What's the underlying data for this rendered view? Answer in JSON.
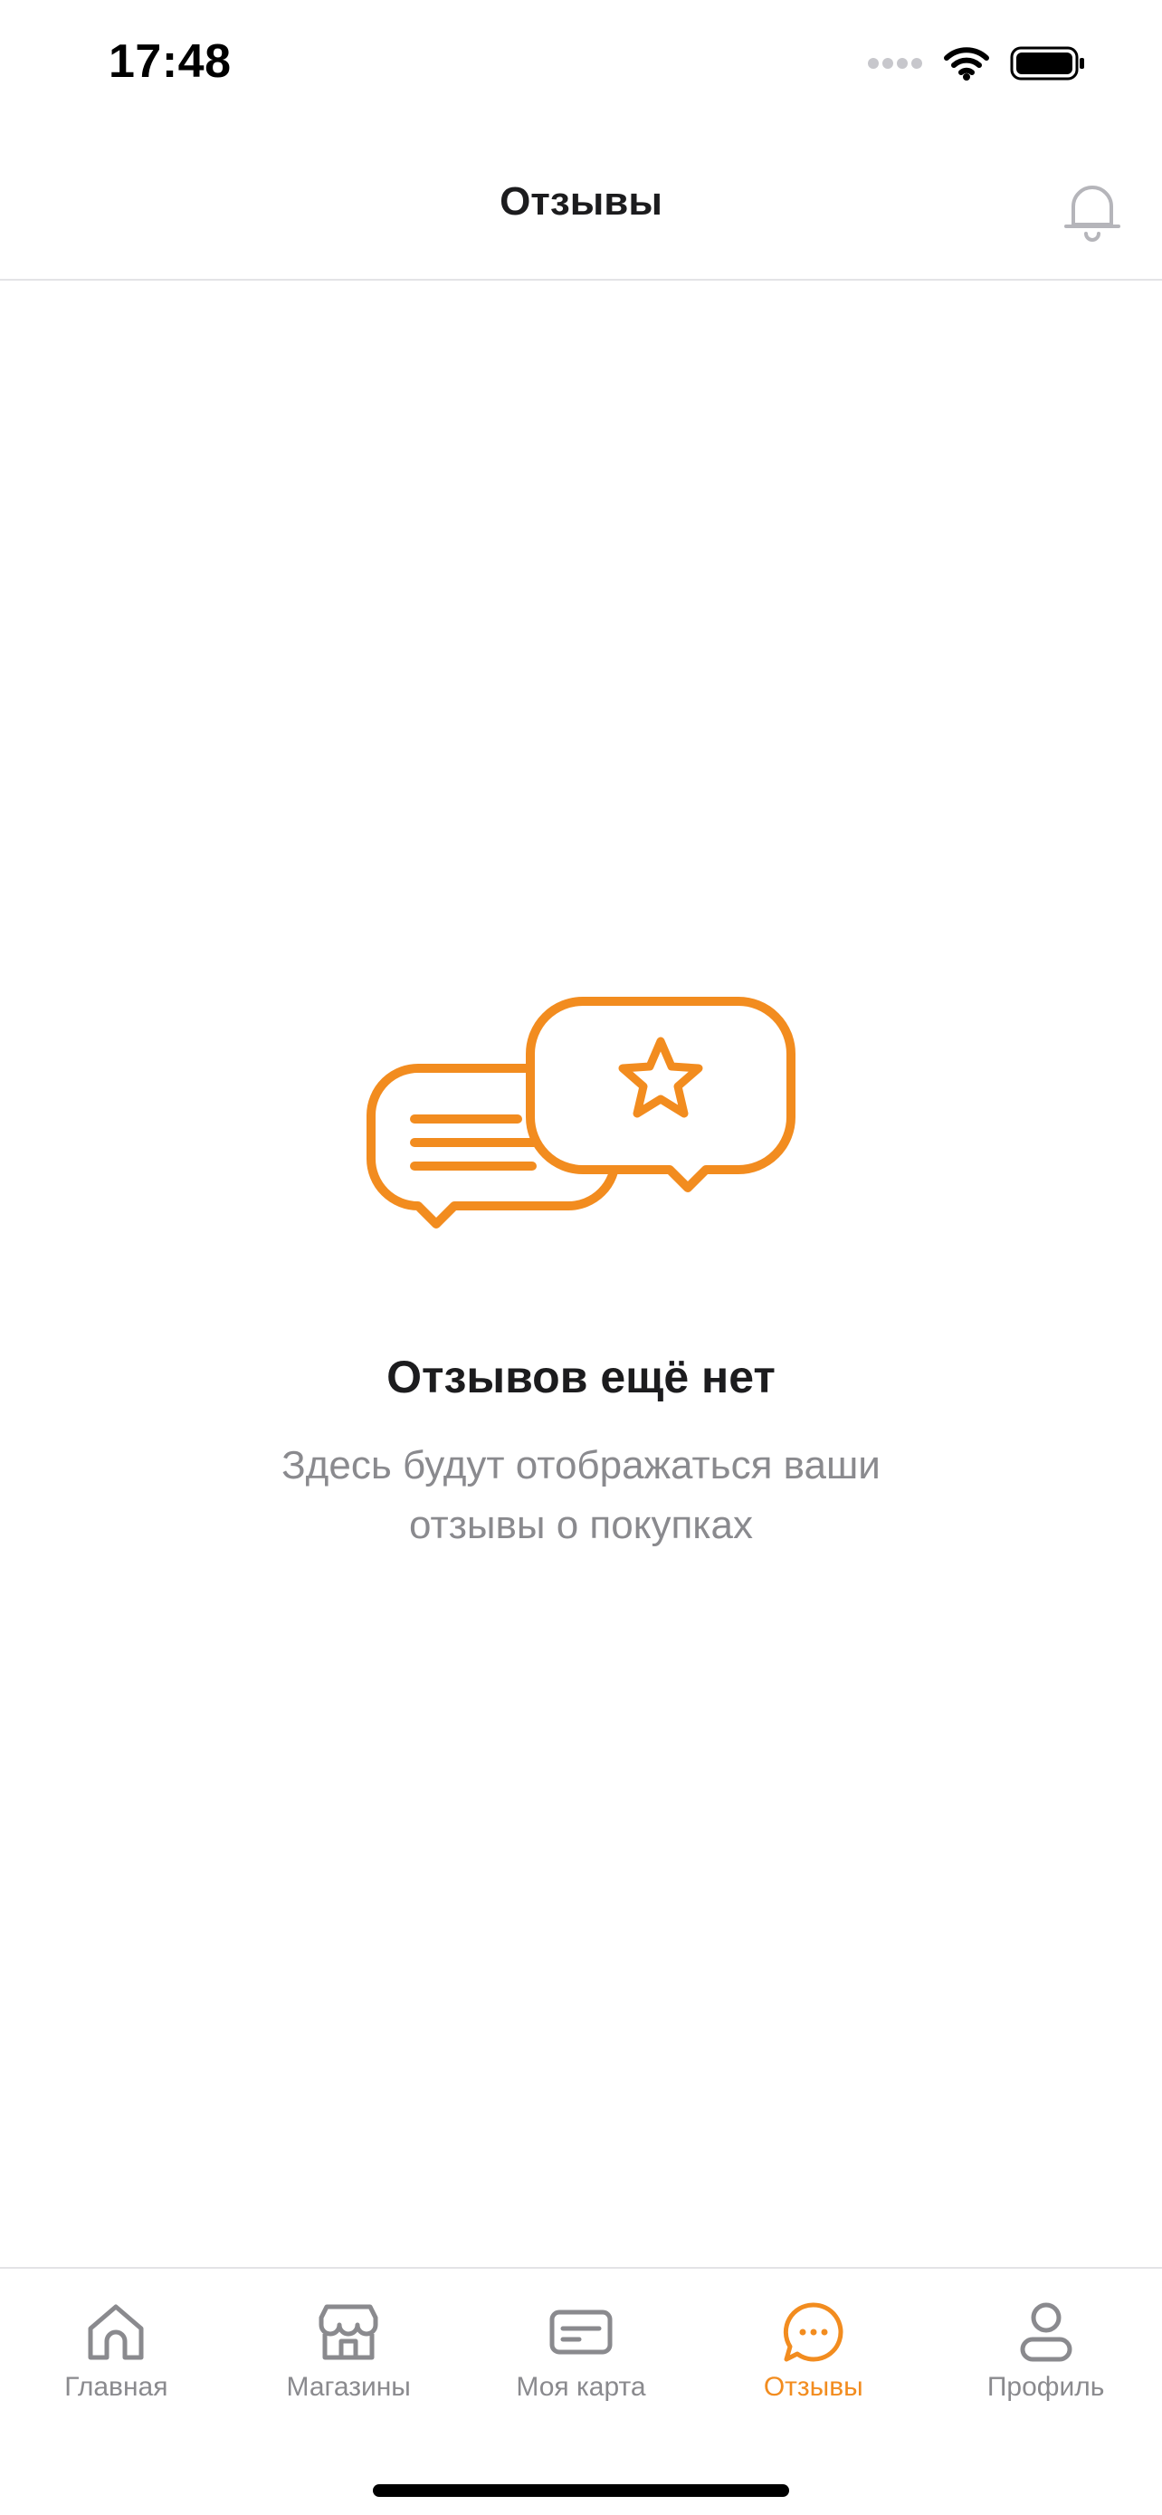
{
  "status_bar": {
    "time": "17:48",
    "icons": [
      "cellular-signal-icon",
      "wifi-icon",
      "battery-icon"
    ]
  },
  "header": {
    "title": "Отзывы",
    "notification_icon": "bell-icon"
  },
  "empty_state": {
    "illustration": "reviews-chat-star-illustration",
    "title": "Отзывов ещё нет",
    "subtitle": "Здесь будут отображаться ваши отзывы о покупках"
  },
  "tabbar": {
    "items": [
      {
        "label": "Главная",
        "icon": "home-icon",
        "active": false
      },
      {
        "label": "Магазины",
        "icon": "store-icon",
        "active": false
      },
      {
        "label": "Моя карта",
        "icon": "card-icon",
        "active": false
      },
      {
        "label": "Отзывы",
        "icon": "chat-bubble-icon",
        "active": true
      },
      {
        "label": "Профиль",
        "icon": "profile-icon",
        "active": false
      }
    ]
  },
  "colors": {
    "accent": "#f28c1f",
    "text_primary": "#1c1c1e",
    "text_secondary": "#8a8a8e",
    "divider": "#e3e3e6"
  }
}
